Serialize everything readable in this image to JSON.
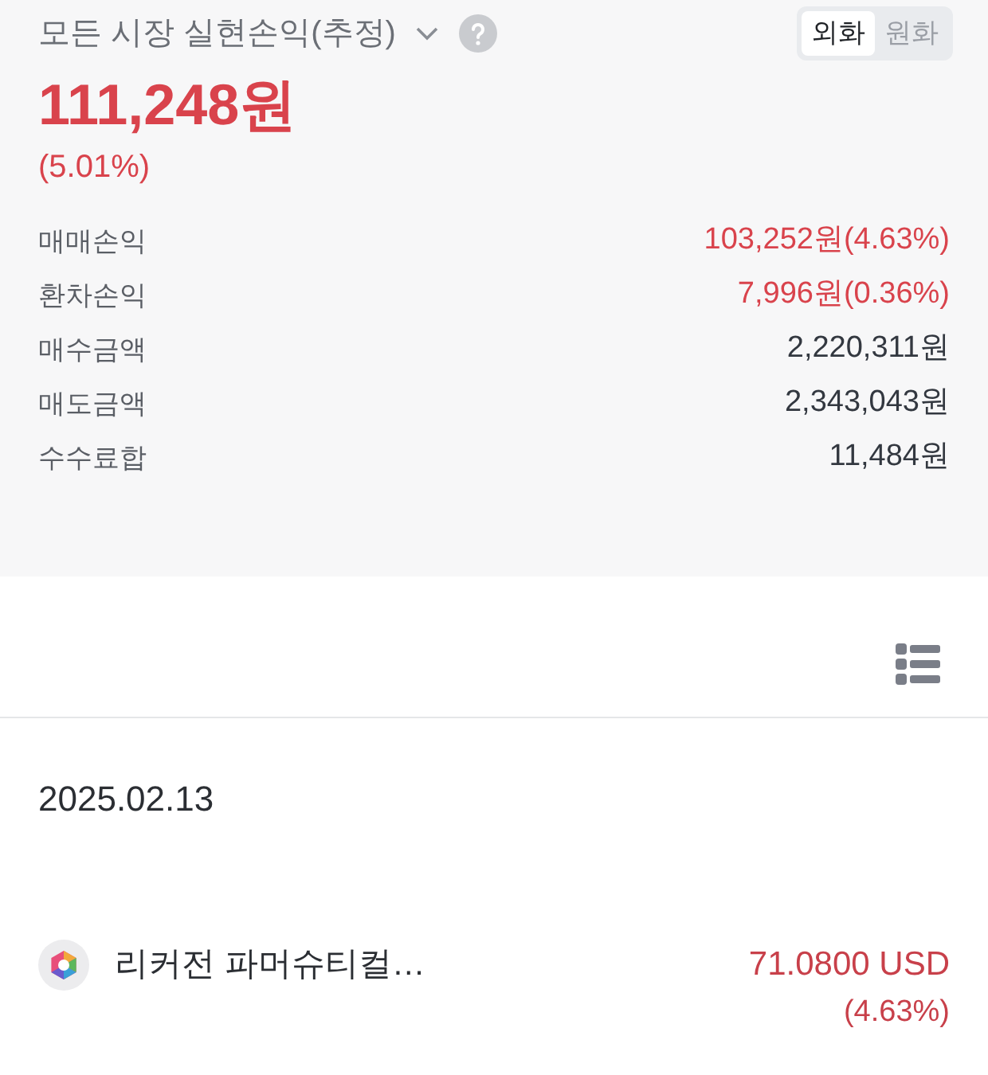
{
  "summary": {
    "title": "모든 시장 실현손익(추정)",
    "currency_tabs": [
      {
        "label": "외화",
        "selected": true
      },
      {
        "label": "원화",
        "selected": false
      }
    ],
    "total": "111,248원",
    "total_rate": "(5.01%)",
    "rows": [
      {
        "label": "매매손익",
        "value": "103,252원(4.63%)",
        "kind": "gain"
      },
      {
        "label": "환차손익",
        "value": "7,996원(0.36%)",
        "kind": "gain"
      },
      {
        "label": "매수금액",
        "value": "2,220,311원",
        "kind": "plain"
      },
      {
        "label": "매도금액",
        "value": "2,343,043원",
        "kind": "plain"
      },
      {
        "label": "수수료합",
        "value": "11,484원",
        "kind": "plain"
      }
    ]
  },
  "history": {
    "date": "2025.02.13",
    "items": [
      {
        "name": "리커전 파머슈티컬…",
        "amount": "71.0800 USD",
        "rate": "(4.63%)"
      }
    ]
  }
}
